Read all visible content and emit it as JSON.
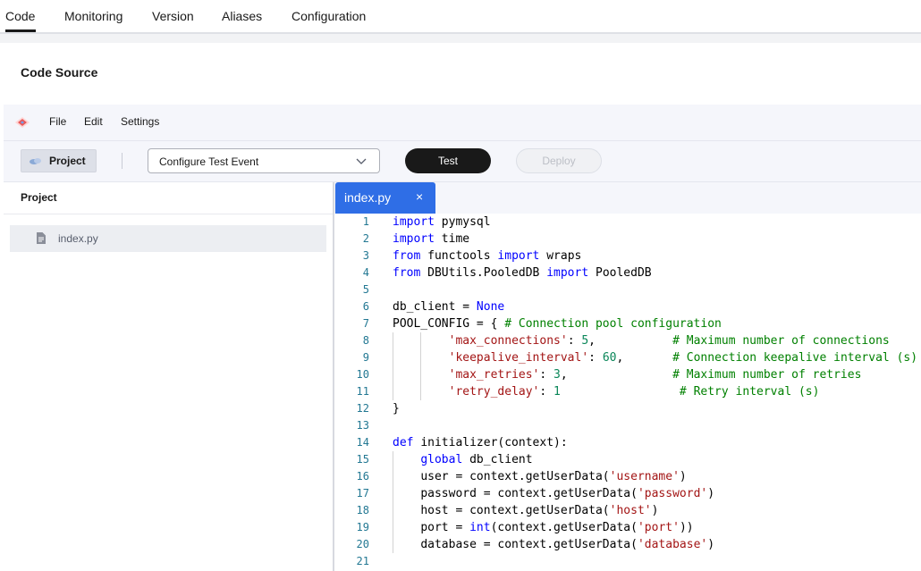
{
  "top_tabs": [
    "Code",
    "Monitoring",
    "Version",
    "Aliases",
    "Configuration"
  ],
  "section_title": "Code Source",
  "menu": [
    "File",
    "Edit",
    "Settings"
  ],
  "toolbar": {
    "project_label": "Project",
    "test_event_select": "Configure Test Event",
    "test_label": "Test",
    "deploy_label": "Deploy"
  },
  "explorer": {
    "title": "Project",
    "files": [
      "index.py"
    ]
  },
  "editor": {
    "tab_name": "index.py",
    "close_glyph": "×",
    "lines": [
      {
        "n": "1",
        "indent": 0,
        "tokens": [
          [
            "kw",
            "import"
          ],
          [
            "",
            "pymysql"
          ]
        ]
      },
      {
        "n": "2",
        "indent": 0,
        "tokens": [
          [
            "kw",
            "import"
          ],
          [
            "",
            "time"
          ]
        ]
      },
      {
        "n": "3",
        "indent": 0,
        "tokens": [
          [
            "kw",
            "from"
          ],
          [
            "",
            "functools"
          ],
          [
            "kw",
            "import"
          ],
          [
            "",
            "wraps"
          ]
        ]
      },
      {
        "n": "4",
        "indent": 0,
        "tokens": [
          [
            "kw",
            "from"
          ],
          [
            "",
            "DBUtils.PooledDB"
          ],
          [
            "kw",
            "import"
          ],
          [
            "",
            "PooledDB"
          ]
        ]
      },
      {
        "n": "5",
        "indent": 0,
        "tokens": []
      },
      {
        "n": "6",
        "indent": 0,
        "tokens": [
          [
            "",
            "db_client = "
          ],
          [
            "kw",
            "None"
          ]
        ]
      },
      {
        "n": "7",
        "indent": 0,
        "tokens": [
          [
            "",
            "POOL_CONFIG = { "
          ],
          [
            "cm",
            "# Connection pool configuration"
          ]
        ]
      },
      {
        "n": "8",
        "indent": 2,
        "tokens": [
          [
            "str",
            "'max_connections'"
          ],
          [
            "",
            ": "
          ],
          [
            "num",
            "5"
          ],
          [
            "",
            ",           "
          ],
          [
            "cm",
            "# Maximum number of connections"
          ]
        ]
      },
      {
        "n": "9",
        "indent": 2,
        "tokens": [
          [
            "str",
            "'keepalive_interval'"
          ],
          [
            "",
            ": "
          ],
          [
            "num",
            "60"
          ],
          [
            "",
            ",       "
          ],
          [
            "cm",
            "# Connection keepalive interval (s)"
          ]
        ]
      },
      {
        "n": "10",
        "indent": 2,
        "tokens": [
          [
            "str",
            "'max_retries'"
          ],
          [
            "",
            ": "
          ],
          [
            "num",
            "3"
          ],
          [
            "",
            ",               "
          ],
          [
            "cm",
            "# Maximum number of retries"
          ]
        ]
      },
      {
        "n": "11",
        "indent": 2,
        "tokens": [
          [
            "str",
            "'retry_delay'"
          ],
          [
            "",
            ": "
          ],
          [
            "num",
            "1"
          ],
          [
            "",
            "                 "
          ],
          [
            "cm",
            "# Retry interval (s)"
          ]
        ]
      },
      {
        "n": "12",
        "indent": 0,
        "tokens": [
          [
            "",
            "}"
          ]
        ]
      },
      {
        "n": "13",
        "indent": 0,
        "tokens": []
      },
      {
        "n": "14",
        "indent": 0,
        "tokens": [
          [
            "kw",
            "def"
          ],
          [
            "",
            "initializer(context):"
          ]
        ]
      },
      {
        "n": "15",
        "indent": 1,
        "tokens": [
          [
            "kw",
            "global"
          ],
          [
            "",
            "db_client"
          ]
        ]
      },
      {
        "n": "16",
        "indent": 1,
        "tokens": [
          [
            "",
            "user = context.getUserData("
          ],
          [
            "str",
            "'username'"
          ],
          [
            "",
            ")"
          ]
        ]
      },
      {
        "n": "17",
        "indent": 1,
        "tokens": [
          [
            "",
            "password = context.getUserData("
          ],
          [
            "str",
            "'password'"
          ],
          [
            "",
            ")"
          ]
        ]
      },
      {
        "n": "18",
        "indent": 1,
        "tokens": [
          [
            "",
            "host = context.getUserData("
          ],
          [
            "str",
            "'host'"
          ],
          [
            "",
            ")"
          ]
        ]
      },
      {
        "n": "19",
        "indent": 1,
        "tokens": [
          [
            "",
            "port = "
          ],
          [
            "kw",
            "int"
          ],
          [
            "",
            "(context.getUserData("
          ],
          [
            "str",
            "'port'"
          ],
          [
            "",
            "))"
          ]
        ]
      },
      {
        "n": "20",
        "indent": 1,
        "tokens": [
          [
            "",
            "database = context.getUserData("
          ],
          [
            "str",
            "'database'"
          ],
          [
            "",
            ")"
          ]
        ]
      },
      {
        "n": "21",
        "indent": 0,
        "tokens": []
      }
    ]
  },
  "icons": {
    "logo": "app-logo-icon",
    "project": "project-folder-icon",
    "chevron": "chevron-down-icon",
    "file": "file-icon"
  }
}
